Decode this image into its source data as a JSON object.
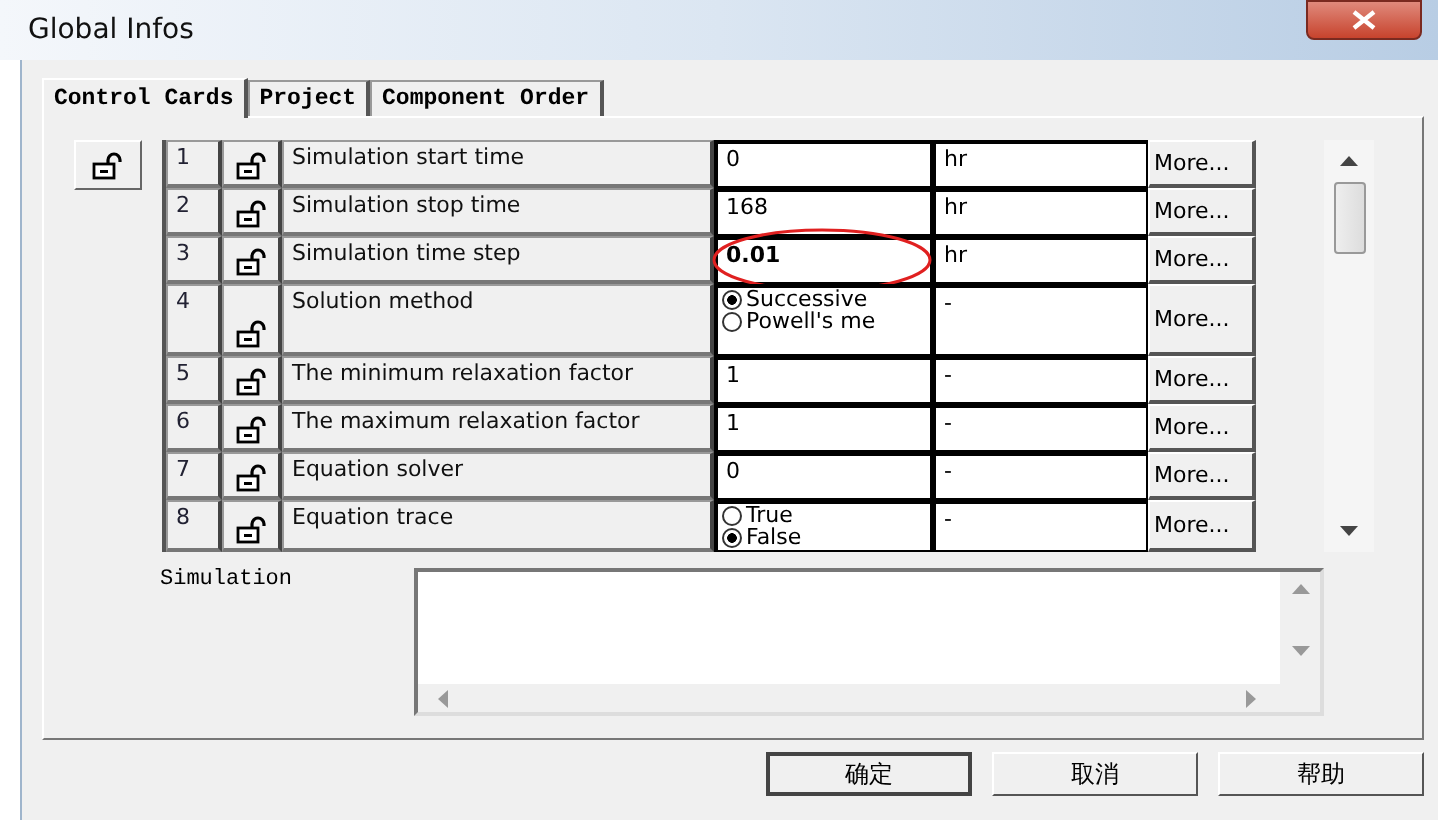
{
  "window": {
    "title": "Global Infos"
  },
  "tabs": [
    {
      "label": "Control Cards",
      "selected": true
    },
    {
      "label": "Project",
      "selected": false
    },
    {
      "label": "Component Order",
      "selected": false
    }
  ],
  "rows": [
    {
      "number": "1",
      "label": "Simulation start time",
      "kind": "text",
      "value": "0",
      "bold": false,
      "circled": false,
      "unit": "hr",
      "more": "More..."
    },
    {
      "number": "2",
      "label": "Simulation stop time",
      "kind": "text",
      "value": "168",
      "bold": false,
      "circled": false,
      "unit": "hr",
      "more": "More..."
    },
    {
      "number": "3",
      "label": "Simulation time step",
      "kind": "text",
      "value": "0.01",
      "bold": true,
      "circled": true,
      "unit": "hr",
      "more": "More..."
    },
    {
      "number": "4",
      "label": "Solution method",
      "kind": "radio",
      "options": [
        {
          "label": "Successive",
          "selected": true
        },
        {
          "label": "Powell's me",
          "selected": false
        }
      ],
      "unit": "-",
      "more": "More..."
    },
    {
      "number": "5",
      "label": "The minimum relaxation factor",
      "kind": "text",
      "value": "1",
      "bold": false,
      "circled": false,
      "unit": "-",
      "more": "More..."
    },
    {
      "number": "6",
      "label": "The maximum relaxation factor",
      "kind": "text",
      "value": "1",
      "bold": false,
      "circled": false,
      "unit": "-",
      "more": "More..."
    },
    {
      "number": "7",
      "label": "Equation solver",
      "kind": "text",
      "value": "0",
      "bold": false,
      "circled": false,
      "unit": "-",
      "more": "More..."
    },
    {
      "number": "8",
      "label": "Equation trace",
      "kind": "radio",
      "options": [
        {
          "label": "True",
          "selected": false
        },
        {
          "label": "False",
          "selected": true
        }
      ],
      "unit": "-",
      "more": "More..."
    }
  ],
  "notes": {
    "label": "Simulation"
  },
  "buttons": [
    {
      "label": "确定",
      "default": true
    },
    {
      "label": "取消",
      "default": false
    },
    {
      "label": "帮助",
      "default": false
    }
  ]
}
